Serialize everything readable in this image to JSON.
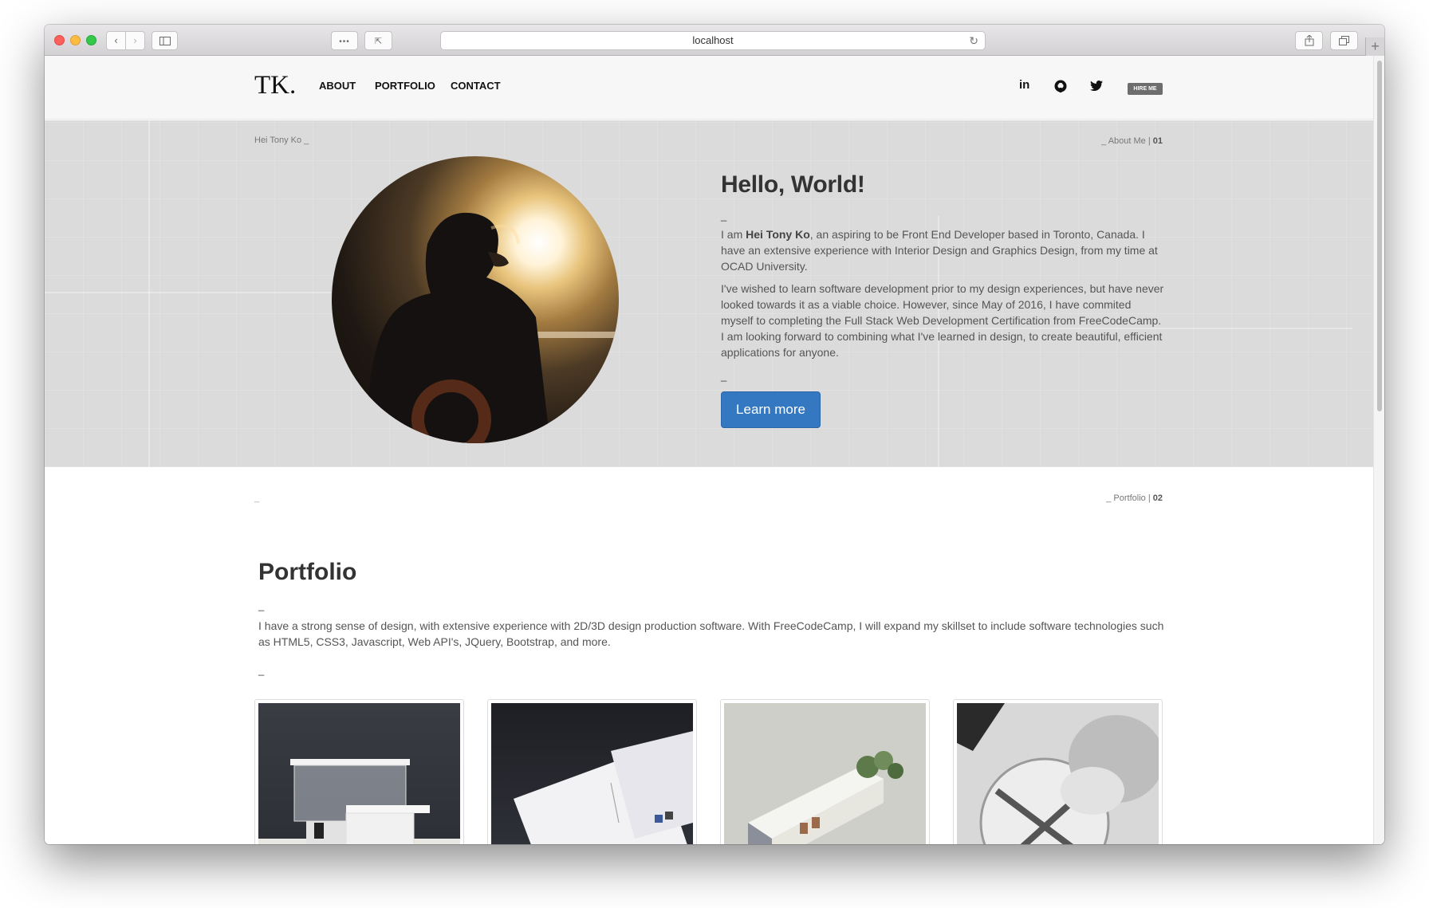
{
  "browser": {
    "url": "localhost"
  },
  "site": {
    "logo": "TK.",
    "nav": [
      "ABOUT",
      "PORTFOLIO",
      "CONTACT"
    ],
    "social": {
      "linkedin": "in",
      "hire": "HIRE ME"
    }
  },
  "hero": {
    "breadcrumb_left": "Hei Tony Ko _",
    "breadcrumb_right_label": "_ About Me | ",
    "breadcrumb_right_num": "01",
    "title": "Hello, World!",
    "dash": "_",
    "p1_pre": "I am ",
    "p1_name": "Hei Tony Ko",
    "p1_post": ", an aspiring to be Front End Developer based in Toronto, Canada. I have an extensive experience with Interior Design and Graphics Design, from my time at OCAD University.",
    "p2": "I've wished to learn software development prior to my design experiences, but have never looked towards it as a viable choice. However, since May of 2016, I have commited myself to completing the Full Stack Web Development Certification from FreeCodeCamp. I am looking forward to combining what I've learned in design, to create beautiful, efficient applications for anyone.",
    "button": "Learn more"
  },
  "portfolio": {
    "breadcrumb_left": "_",
    "breadcrumb_right_label": "_ Portfolio | ",
    "breadcrumb_right_num": "02",
    "title": "Portfolio",
    "dash": "_",
    "description": "I have a strong sense of design, with extensive experience with 2D/3D design production software. With FreeCodeCamp, I will expand my skillset to include software technologies such as HTML5, CSS3, Javascript, Web API's, JQuery, Bootstrap, and more."
  }
}
